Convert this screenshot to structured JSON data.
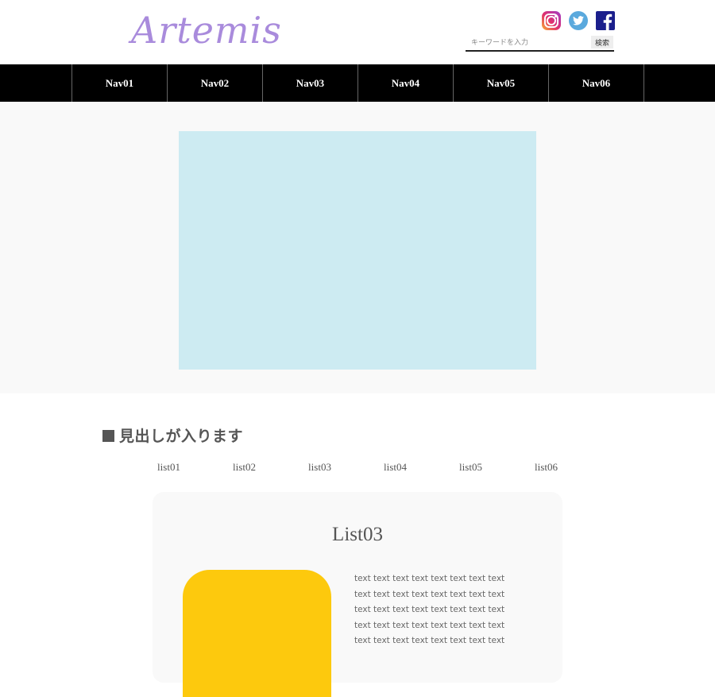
{
  "header": {
    "logo": "Artemis",
    "social": [
      "instagram-icon",
      "twitter-icon",
      "facebook-icon"
    ],
    "search": {
      "placeholder": "キーワードを入力",
      "button_label": "検索"
    }
  },
  "nav": {
    "items": [
      "Nav01",
      "Nav02",
      "Nav03",
      "Nav04",
      "Nav05",
      "Nav06"
    ]
  },
  "hero": {
    "color": "#cdebf2"
  },
  "section": {
    "heading": "見出しが入ります",
    "tabs": [
      "list01",
      "list02",
      "list03",
      "list04",
      "list05",
      "list06"
    ],
    "card": {
      "title": "List03",
      "text": "text text text text text text text text text text text text text text text text text text text text text text text text text text text text text text text text text text text text text text text text",
      "image_color": "#fdc90d"
    }
  },
  "colors": {
    "logo": "#a98bdc",
    "nav_bg": "#000000",
    "twitter": "#5aa9dd",
    "facebook": "#1b1f8c"
  }
}
